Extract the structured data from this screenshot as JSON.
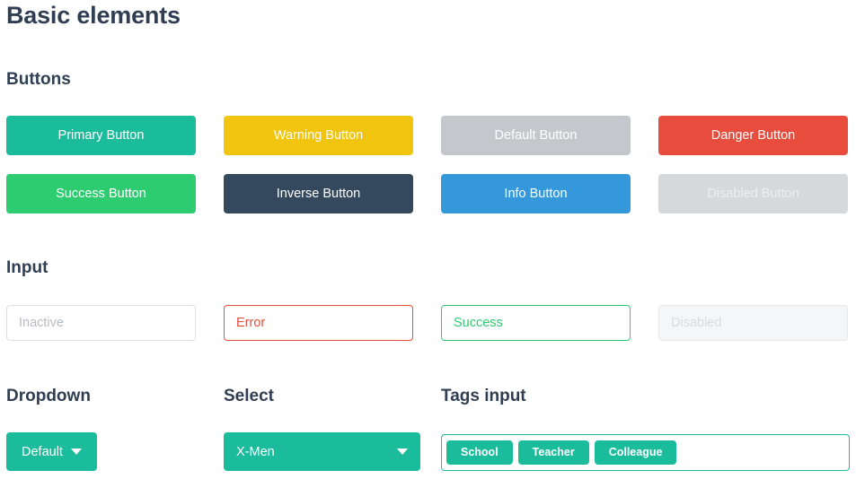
{
  "page": {
    "title": "Basic elements"
  },
  "sections": {
    "buttons": {
      "title": "Buttons"
    },
    "input": {
      "title": "Input"
    },
    "dropdown": {
      "title": "Dropdown"
    },
    "select": {
      "title": "Select"
    },
    "tags": {
      "title": "Tags input"
    }
  },
  "colors": {
    "primary": "#1abc9c",
    "warning": "#f1c40f",
    "default": "#c4c8cc",
    "danger": "#e74c3c",
    "success": "#2ecc71",
    "inverse": "#34495e",
    "info": "#3498db",
    "disabled": "#d5d9dc",
    "heading": "#2f3e53"
  },
  "buttons": [
    {
      "label": "Primary Button",
      "style": "primary",
      "bg": "#1abc9c",
      "fg": "#ffffff"
    },
    {
      "label": "Warning Button",
      "style": "warning",
      "bg": "#f1c40f",
      "fg": "#ffffff"
    },
    {
      "label": "Default Button",
      "style": "default",
      "bg": "#c4c8cc",
      "fg": "#ffffff"
    },
    {
      "label": "Danger Button",
      "style": "danger",
      "bg": "#e74c3c",
      "fg": "#ffffff"
    },
    {
      "label": "Success Button",
      "style": "success",
      "bg": "#2ecc71",
      "fg": "#ffffff"
    },
    {
      "label": "Inverse Button",
      "style": "inverse",
      "bg": "#34495e",
      "fg": "#ffffff"
    },
    {
      "label": "Info Button",
      "style": "info",
      "bg": "#3498db",
      "fg": "#ffffff"
    },
    {
      "label": "Disabled Button",
      "style": "disabled",
      "bg": "#d5d9dc",
      "fg": "#eceff1"
    }
  ],
  "inputs": [
    {
      "state": "inactive",
      "value": "",
      "placeholder": "Inactive"
    },
    {
      "state": "error",
      "value": "",
      "placeholder": "Error"
    },
    {
      "state": "success",
      "value": "",
      "placeholder": "Success"
    },
    {
      "state": "disabled",
      "value": "",
      "placeholder": "Disabled"
    }
  ],
  "dropdown": {
    "selected": "Default",
    "caret_icon": "chevron-down-icon"
  },
  "select": {
    "selected": "X-Men",
    "caret_icon": "chevron-down-icon"
  },
  "tags": {
    "items": [
      "School",
      "Teacher",
      "Colleague"
    ],
    "input_value": "",
    "input_placeholder": ""
  }
}
